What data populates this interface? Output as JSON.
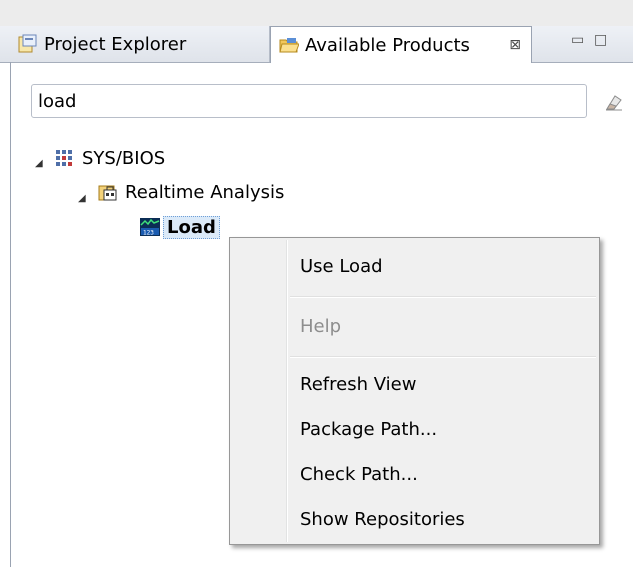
{
  "tabs": {
    "project_explorer": {
      "label": "Project Explorer",
      "icon": "project-explorer-icon"
    },
    "available_products": {
      "label": "Available Products",
      "icon": "folder-open-icon",
      "close": "⊠"
    }
  },
  "view_controls": {
    "minimize": "▭",
    "maximize": "□"
  },
  "search": {
    "value": "load",
    "clear_icon": "eraser-icon"
  },
  "tree": [
    {
      "label": "SYS/BIOS",
      "icon": "package-grid-icon",
      "expanded": true
    },
    {
      "label": "Realtime Analysis",
      "icon": "package-folder-icon",
      "expanded": true
    },
    {
      "label": "Load",
      "icon": "load-monitor-icon",
      "selected": true
    }
  ],
  "tree_expander": "◢",
  "context_menu": {
    "items": [
      {
        "label": "Use Load",
        "enabled": true
      },
      {
        "label": "Help",
        "enabled": false
      },
      {
        "label": "Refresh View",
        "enabled": true
      },
      {
        "label": "Package Path...",
        "enabled": true
      },
      {
        "label": "Check Path...",
        "enabled": true
      },
      {
        "label": "Show Repositories",
        "enabled": true
      }
    ]
  }
}
